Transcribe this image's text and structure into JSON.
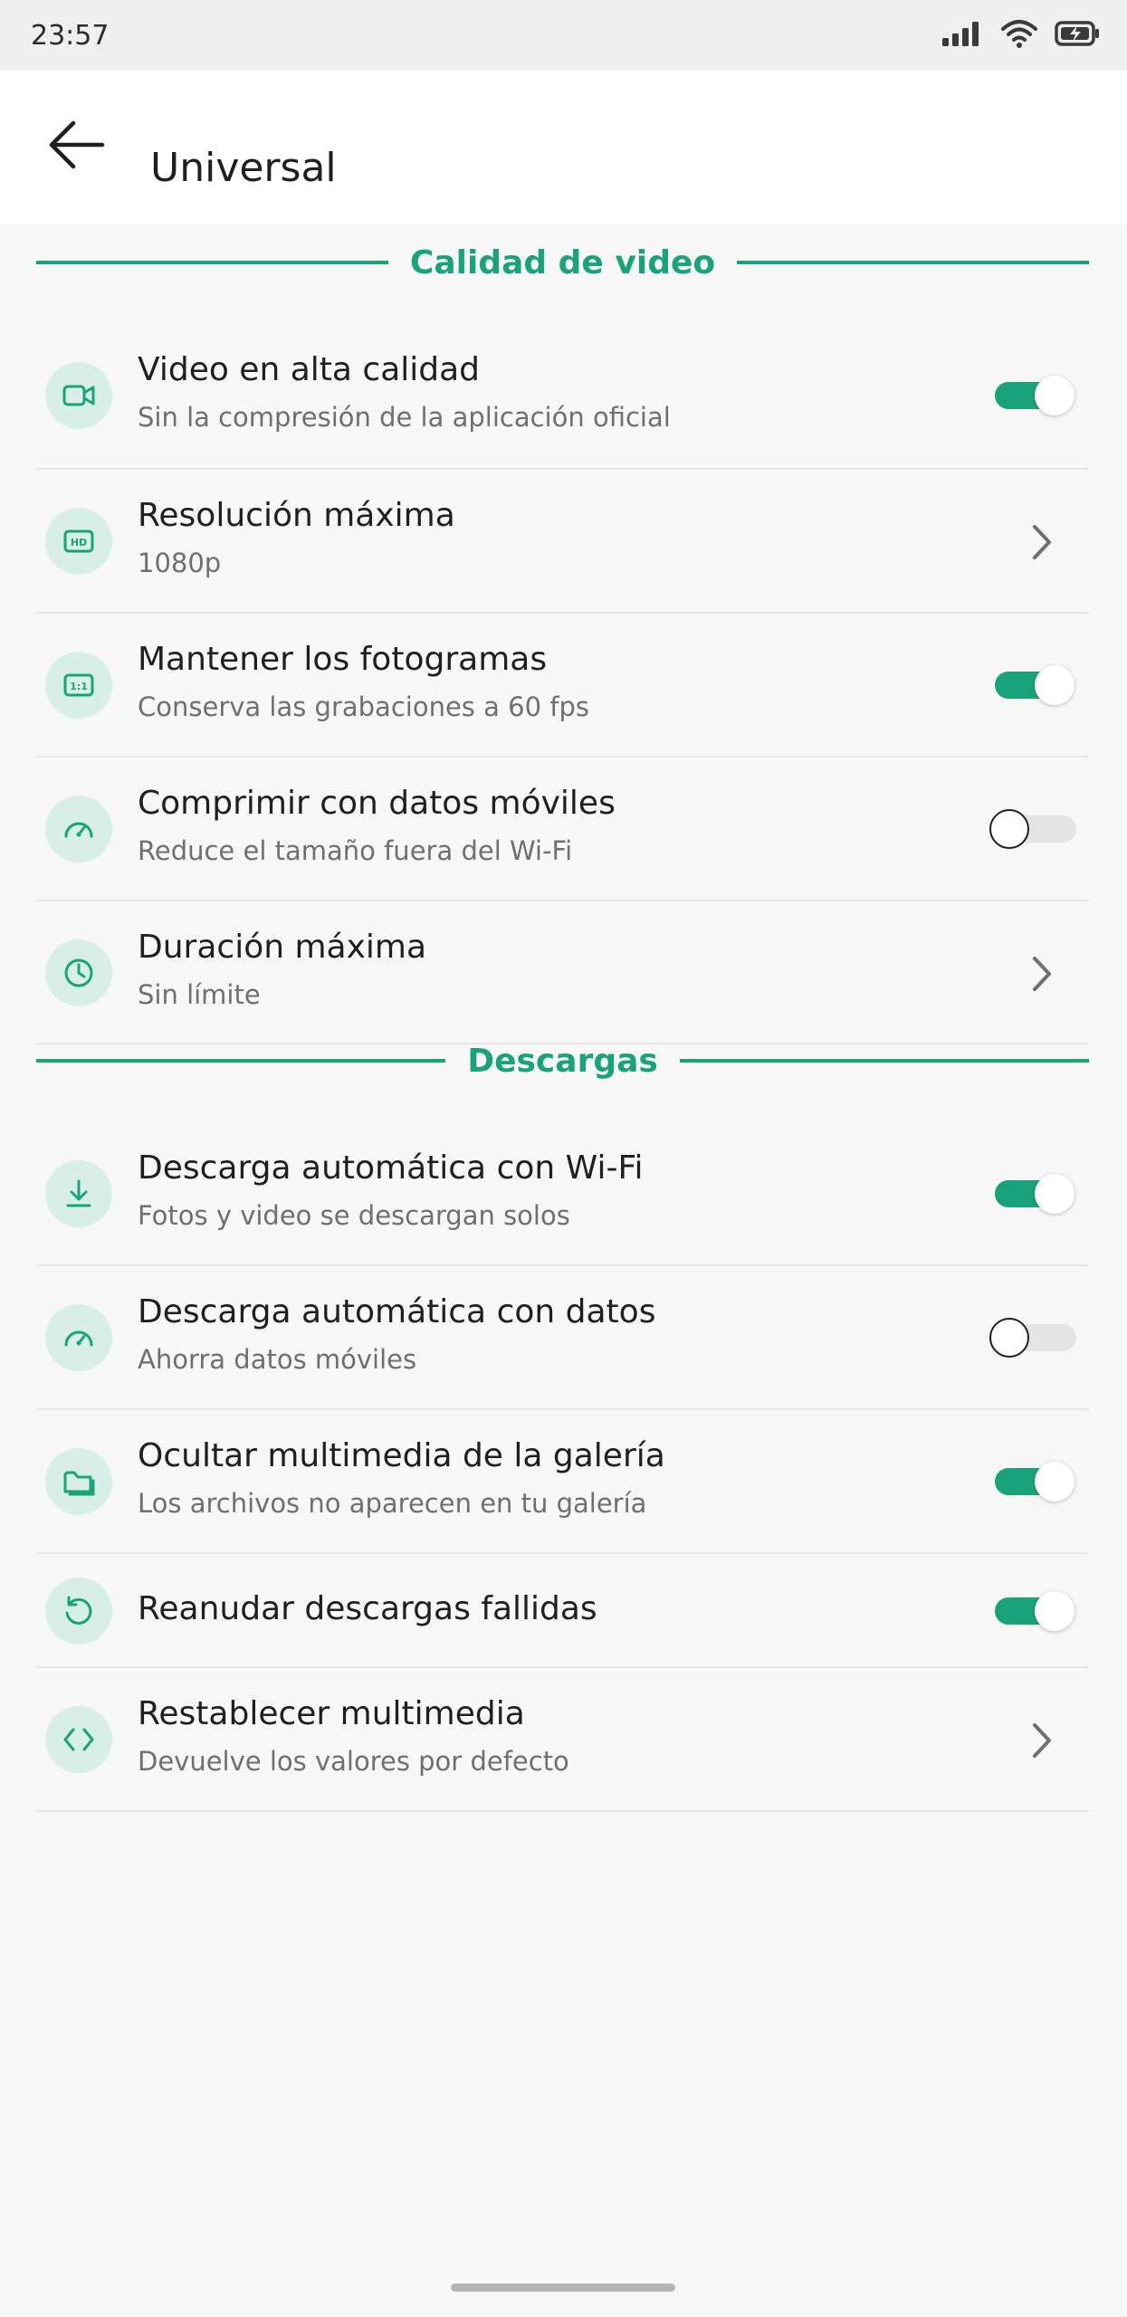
{
  "status_bar": {
    "time": "23:57",
    "icons": [
      "signal-icon",
      "wifi-icon",
      "battery-charging-icon"
    ]
  },
  "app_bar": {
    "back_icon": "arrow-left-icon",
    "title": "Universal"
  },
  "colors": {
    "accent": "#1aa37a",
    "icon_bg": "#d7efe6",
    "background": "#f7f7f7"
  },
  "sections": {
    "video": {
      "title": "Calidad de video",
      "items": [
        {
          "icon": "video-camera-icon",
          "title": "Video en alta calidad",
          "subtitle": "Sin la compresión de la aplicación oficial",
          "control": "toggle",
          "checked": true
        },
        {
          "icon": "hd-icon",
          "title": "Resolución máxima",
          "subtitle": "1080p",
          "control": "chevron"
        },
        {
          "icon": "aspect-ratio-icon",
          "title": "Mantener los fotogramas",
          "subtitle": "Conserva las grabaciones a 60 fps",
          "control": "toggle",
          "checked": true
        },
        {
          "icon": "speedometer-icon",
          "title": "Comprimir con datos móviles",
          "subtitle": "Reduce el tamaño fuera del Wi-Fi",
          "control": "toggle",
          "checked": false
        },
        {
          "icon": "clock-icon",
          "title": "Duración máxima",
          "subtitle": "Sin límite",
          "control": "chevron"
        }
      ]
    },
    "downloads": {
      "title": "Descargas",
      "items": [
        {
          "icon": "download-icon",
          "title": "Descarga automática con Wi-Fi",
          "subtitle": "Fotos y video se descargan solos",
          "control": "toggle",
          "checked": true
        },
        {
          "icon": "speedometer-icon",
          "title": "Descarga automática con datos",
          "subtitle": "Ahorra datos móviles",
          "control": "toggle",
          "checked": false
        },
        {
          "icon": "folder-icon",
          "title": "Ocultar multimedia de la galería",
          "subtitle": "Los archivos no aparecen en tu galería",
          "control": "toggle",
          "checked": true
        },
        {
          "icon": "retry-icon",
          "title": "Reanudar descargas fallidas",
          "subtitle": "",
          "control": "toggle",
          "checked": true
        },
        {
          "icon": "code-icon",
          "title": "Restablecer multimedia",
          "subtitle": "Devuelve los valores por defecto",
          "control": "chevron"
        }
      ]
    }
  }
}
